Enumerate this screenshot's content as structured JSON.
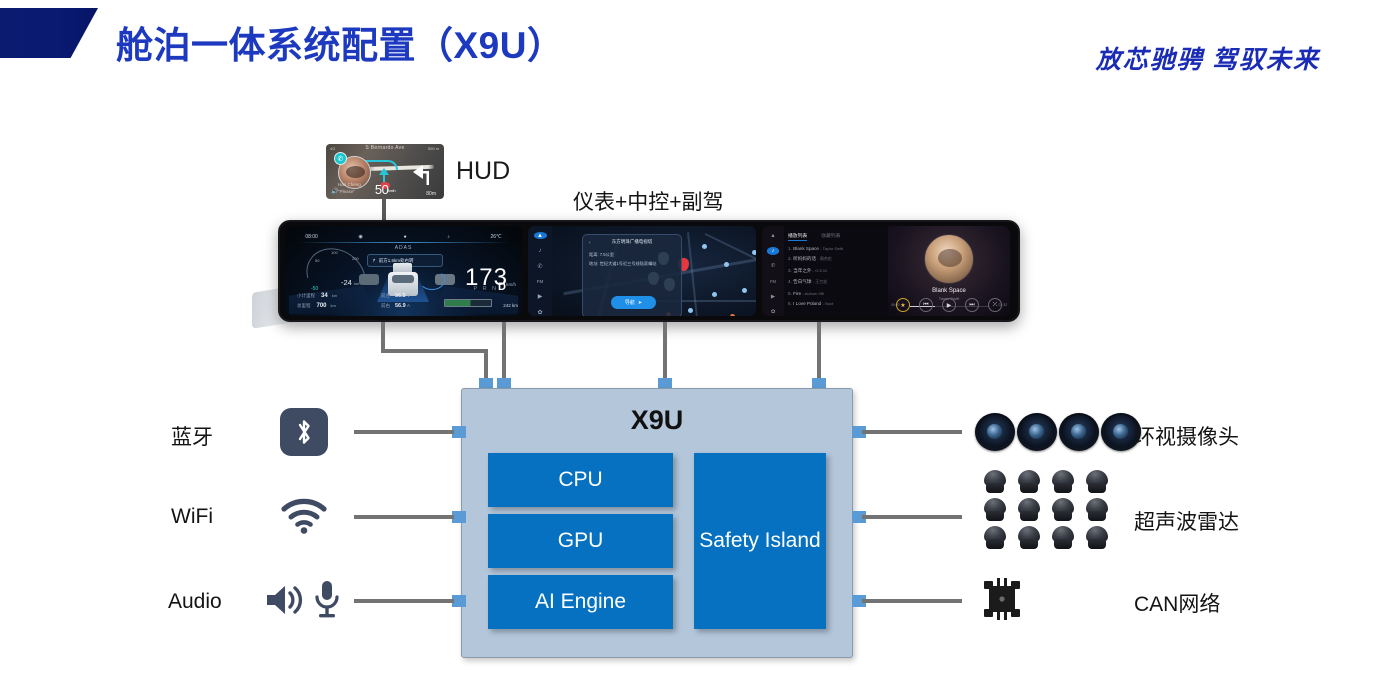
{
  "header": {
    "title": "舱泊一体系统配置（X9U）",
    "slogan": "放芯驰骋  驾驭未来",
    "banner_color": "#0a1a72",
    "title_color": "#1c39c0"
  },
  "diagram": {
    "hud_label": "HUD",
    "display_label": "仪表+中控+副驾",
    "chip": {
      "title": "X9U",
      "fill_color": "#b3c6da",
      "block_color": "#0571c0",
      "pin_color": "#5b9bd5",
      "blocks": [
        {
          "label": "CPU"
        },
        {
          "label": "GPU"
        },
        {
          "label": "AI Engine"
        },
        {
          "label": "Safety Island"
        }
      ]
    },
    "left_peripherals": [
      {
        "label": "蓝牙",
        "icon": "bluetooth-icon"
      },
      {
        "label": "WiFi",
        "icon": "wifi-icon"
      },
      {
        "label": "Audio",
        "icon": "speaker-microphone-icon"
      }
    ],
    "right_peripherals": [
      {
        "label": "环视摄像头",
        "icon": "camera-lens-icon",
        "count": 4
      },
      {
        "label": "超声波雷达",
        "icon": "ultrasonic-sensor-icon",
        "count": 12
      },
      {
        "label": "CAN网络",
        "icon": "vehicle-chassis-icon",
        "count": 1
      }
    ]
  },
  "hud_screen": {
    "street": "S Bernardo Ave",
    "distance_top": "500 m",
    "signal": "4G",
    "caller_name": "Han Cheng",
    "caller_msg": "\"Please\"",
    "speed": "50",
    "speed_unit": "km/h",
    "turn_distance": "80m"
  },
  "cluster_screen": {
    "time": "08:00",
    "temp": "26℃",
    "mode": "ADAS",
    "nav_hint": "前方1.5km处右转",
    "speed": "173",
    "speed_unit": "km/h",
    "gauge_ticks": [
      "50",
      "100",
      "200"
    ],
    "small_speed": "-24",
    "small_speed_unit": "km",
    "neg_tick": "-50",
    "trip_label": "小计里程",
    "trip_value": "34",
    "trip_unit": "km",
    "total_label": "总里程",
    "total_value": "700",
    "total_unit": "km",
    "front_label": "前左",
    "front_value": "56.5",
    "front_unit": "V",
    "rear_label": "前右",
    "rear_value": "56.9",
    "rear_unit": "A",
    "gear_options": "P R N",
    "gear_active": "D",
    "range": "242 km"
  },
  "center_screen": {
    "card_title": "东方明珠广播电视塔",
    "field_distance_label": "距离:",
    "field_distance_value": "7.5公里",
    "field_address_label": "地址:",
    "field_address_value": "世纪大道1号近三号线陆家嘴站",
    "nav_button": "导航",
    "rail_icons": [
      "nav-icon",
      "music-icon",
      "phone-icon",
      "fm-icon",
      "media-icon",
      "settings-icon"
    ]
  },
  "passenger_screen": {
    "tab_active": "播放列表",
    "tab_inactive": "收藏列表",
    "tracks": [
      {
        "num": "1.",
        "title": "Blank Space",
        "artist": "Taylor Swift"
      },
      {
        "num": "2.",
        "title": "听妈妈的话",
        "artist": "周杰伦"
      },
      {
        "num": "3.",
        "title": "当年之外",
        "artist": "G.E.M."
      },
      {
        "num": "4.",
        "title": "告白气球",
        "artist": "王力宏"
      },
      {
        "num": "5.",
        "title": "Fire",
        "artist": "Auburn Hill"
      },
      {
        "num": "6.",
        "title": "I Love Poland",
        "artist": "Noot"
      }
    ],
    "now_title": "Blank Space",
    "now_artist": "Taylor Swift",
    "time_elapsed": "00:00",
    "time_total": "03:32",
    "controls": [
      "favorite-icon",
      "previous-icon",
      "play-icon",
      "next-icon",
      "shuffle-icon"
    ],
    "rail_icons": [
      "nav-icon",
      "music-icon",
      "phone-icon",
      "fm-icon",
      "media-icon",
      "settings-icon"
    ]
  }
}
